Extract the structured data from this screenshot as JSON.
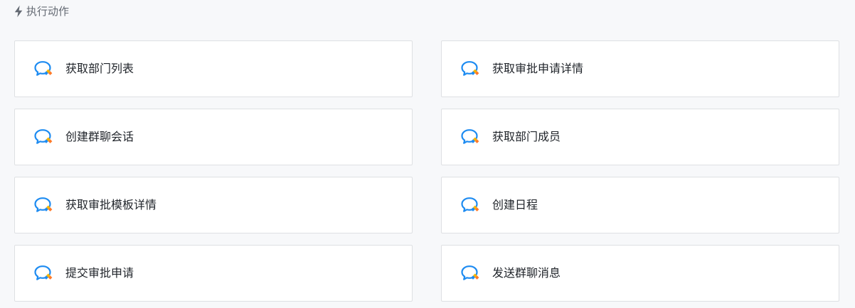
{
  "section": {
    "title": "执行动作",
    "icon": "lightning-icon"
  },
  "actions": [
    {
      "label": "获取部门列表",
      "icon": "wecom-chat-icon"
    },
    {
      "label": "获取审批申请详情",
      "icon": "wecom-chat-icon"
    },
    {
      "label": "创建群聊会话",
      "icon": "wecom-chat-icon"
    },
    {
      "label": "获取部门成员",
      "icon": "wecom-chat-icon"
    },
    {
      "label": "获取审批模板详情",
      "icon": "wecom-chat-icon"
    },
    {
      "label": "创建日程",
      "icon": "wecom-chat-icon"
    },
    {
      "label": "提交审批申请",
      "icon": "wecom-chat-icon"
    },
    {
      "label": "发送群聊消息",
      "icon": "wecom-chat-icon"
    }
  ],
  "colors": {
    "page_bg": "#f7f8fa",
    "card_bg": "#ffffff",
    "card_border": "#dee0e3",
    "text": "#1f2329",
    "muted_text": "#646a73",
    "icon_blue": "#1d8bf1",
    "icon_yellow": "#f7b500",
    "icon_orange": "#ff7a28"
  }
}
